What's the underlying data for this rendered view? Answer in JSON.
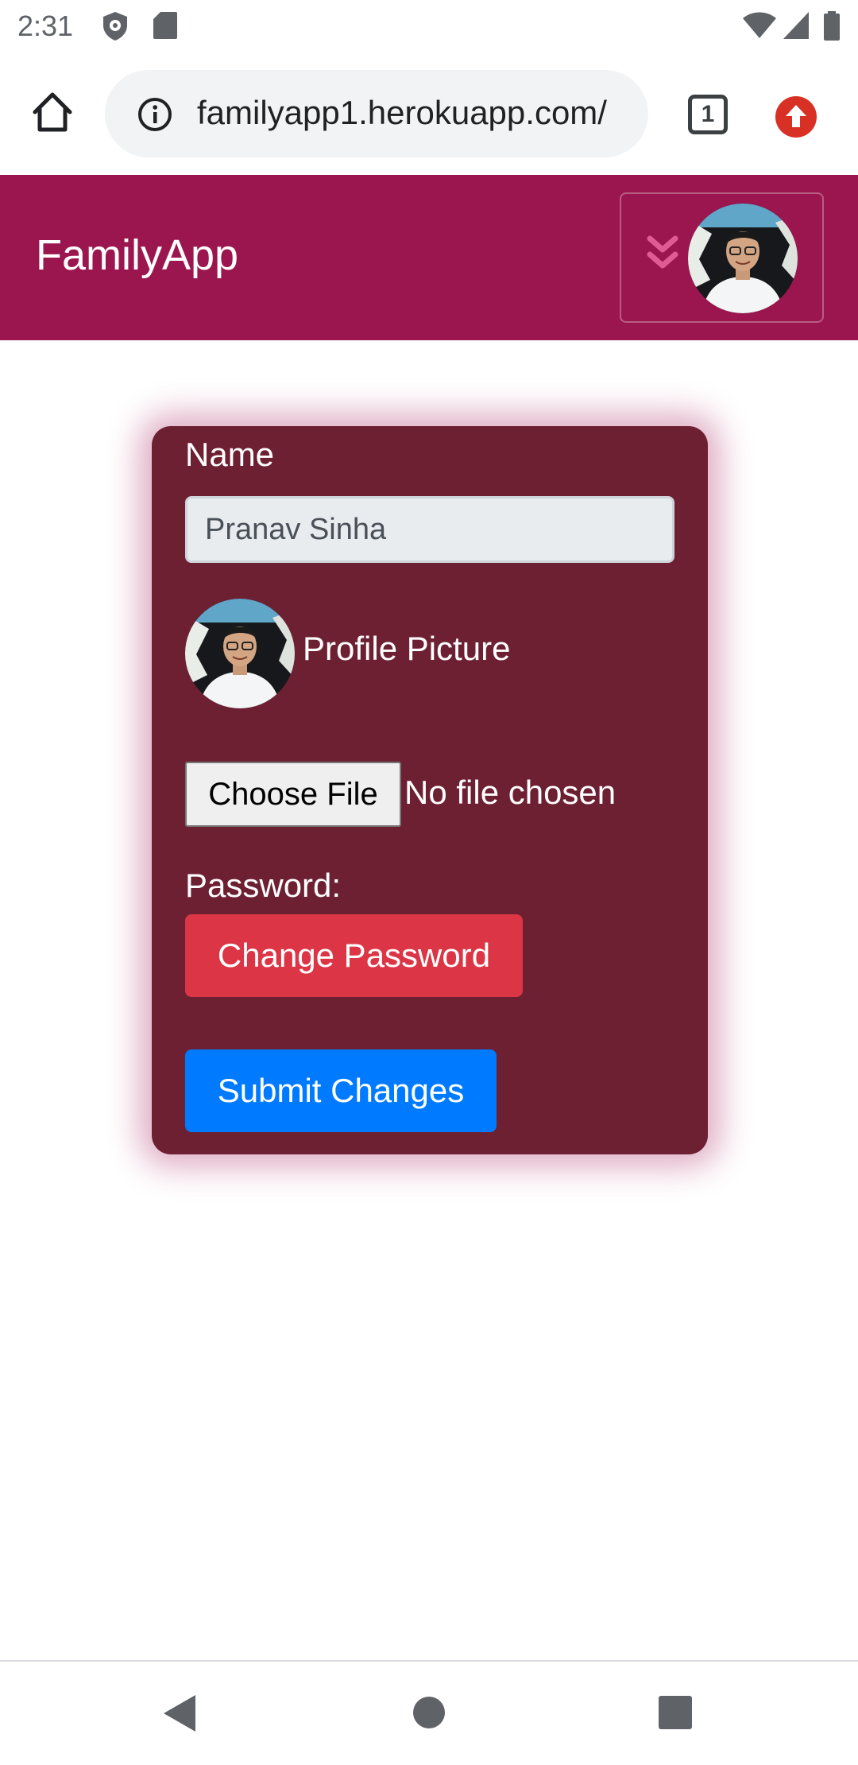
{
  "status_bar": {
    "time": "2:31",
    "icons": [
      "vpn-shield-icon",
      "sd-card-icon",
      "wifi-icon",
      "cell-signal-icon",
      "battery-icon"
    ]
  },
  "browser": {
    "url": "familyapp1.herokuapp.com/",
    "tab_count": "1",
    "icons": [
      "home-icon",
      "info-icon",
      "tab-switcher-icon",
      "update-icon"
    ]
  },
  "navbar": {
    "brand": "FamilyApp",
    "background": "#9b164e",
    "toggle_icon": "double-chevron-down-icon"
  },
  "form": {
    "card_background": "#6e2033",
    "name_label": "Name",
    "name_value": "Pranav Sinha",
    "profile_picture_label": "Profile Picture",
    "choose_file_label": "Choose File",
    "no_file_text": "No file chosen",
    "password_label": "Password:",
    "change_password_label": "Change Password",
    "change_password_color": "#dc3545",
    "submit_label": "Submit Changes",
    "submit_color": "#007bff"
  },
  "android_nav": {
    "icons": [
      "back-icon",
      "home-circle-icon",
      "recents-icon"
    ]
  }
}
